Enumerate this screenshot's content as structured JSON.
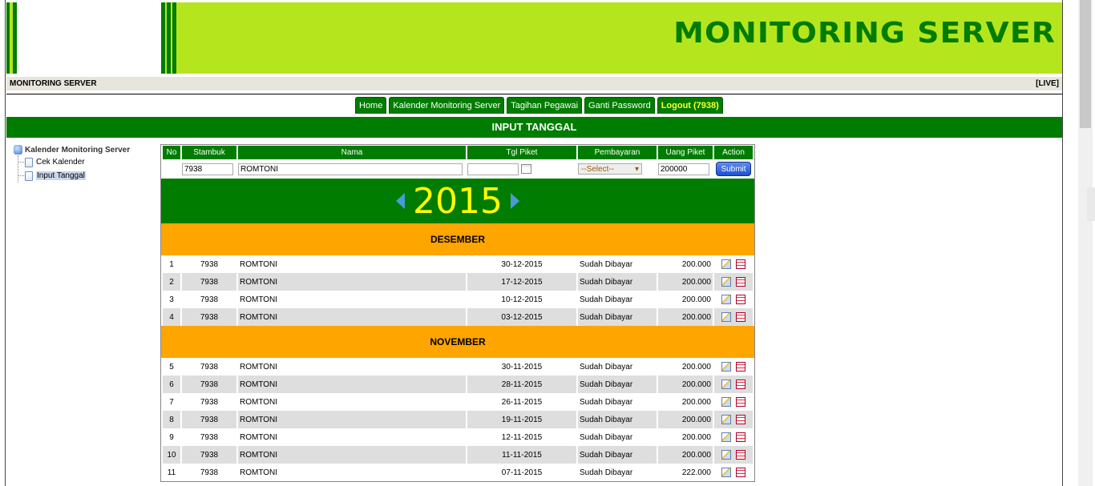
{
  "app": {
    "title": "MONITORING SERVER",
    "info_left": "MONITORING SERVER",
    "info_right": "[LIVE]",
    "colors": {
      "green": "#007c00",
      "lime": "#b5e61d",
      "orange": "#ffa500",
      "yellow": "#ffff00"
    }
  },
  "nav": [
    {
      "label": "Home"
    },
    {
      "label": "Kalender Monitoring Server"
    },
    {
      "label": "Tagihan Pegawai"
    },
    {
      "label": "Ganti Password"
    },
    {
      "label": "Logout (7938)"
    }
  ],
  "section_title": "INPUT TANGGAL",
  "sidebar": {
    "root": "Kalender Monitoring Server",
    "items": [
      {
        "label": "Cek Kalender"
      },
      {
        "label": "Input Tanggal"
      }
    ]
  },
  "table": {
    "headers": [
      "No",
      "Stambuk",
      "Nama",
      "Tgl Piket",
      "Pembayaran",
      "Uang Piket",
      "Action"
    ],
    "input": {
      "stambuk": "7938",
      "nama": "ROMTONI",
      "tgl": "",
      "pembayaran": "--Select--",
      "uang": "200000",
      "submit": "Submit"
    },
    "year": "2015",
    "months": [
      {
        "name": "DESEMBER",
        "rows": [
          {
            "no": "1",
            "stambuk": "7938",
            "nama": "ROMTONI",
            "tgl": "30-12-2015",
            "status": "Sudah Dibayar",
            "uang": "200.000"
          },
          {
            "no": "2",
            "stambuk": "7938",
            "nama": "ROMTONI",
            "tgl": "17-12-2015",
            "status": "Sudah Dibayar",
            "uang": "200.000"
          },
          {
            "no": "3",
            "stambuk": "7938",
            "nama": "ROMTONI",
            "tgl": "10-12-2015",
            "status": "Sudah Dibayar",
            "uang": "200.000"
          },
          {
            "no": "4",
            "stambuk": "7938",
            "nama": "ROMTONI",
            "tgl": "03-12-2015",
            "status": "Sudah Dibayar",
            "uang": "200.000"
          }
        ]
      },
      {
        "name": "NOVEMBER",
        "rows": [
          {
            "no": "5",
            "stambuk": "7938",
            "nama": "ROMTONI",
            "tgl": "30-11-2015",
            "status": "Sudah Dibayar",
            "uang": "200.000"
          },
          {
            "no": "6",
            "stambuk": "7938",
            "nama": "ROMTONI",
            "tgl": "28-11-2015",
            "status": "Sudah Dibayar",
            "uang": "200.000"
          },
          {
            "no": "7",
            "stambuk": "7938",
            "nama": "ROMTONI",
            "tgl": "26-11-2015",
            "status": "Sudah Dibayar",
            "uang": "200.000"
          },
          {
            "no": "8",
            "stambuk": "7938",
            "nama": "ROMTONI",
            "tgl": "19-11-2015",
            "status": "Sudah Dibayar",
            "uang": "200.000"
          },
          {
            "no": "9",
            "stambuk": "7938",
            "nama": "ROMTONI",
            "tgl": "12-11-2015",
            "status": "Sudah Dibayar",
            "uang": "200.000"
          },
          {
            "no": "10",
            "stambuk": "7938",
            "nama": "ROMTONI",
            "tgl": "11-11-2015",
            "status": "Sudah Dibayar",
            "uang": "200.000"
          },
          {
            "no": "11",
            "stambuk": "7938",
            "nama": "ROMTONI",
            "tgl": "07-11-2015",
            "status": "Sudah Dibayar",
            "uang": "222.000"
          }
        ]
      }
    ]
  }
}
